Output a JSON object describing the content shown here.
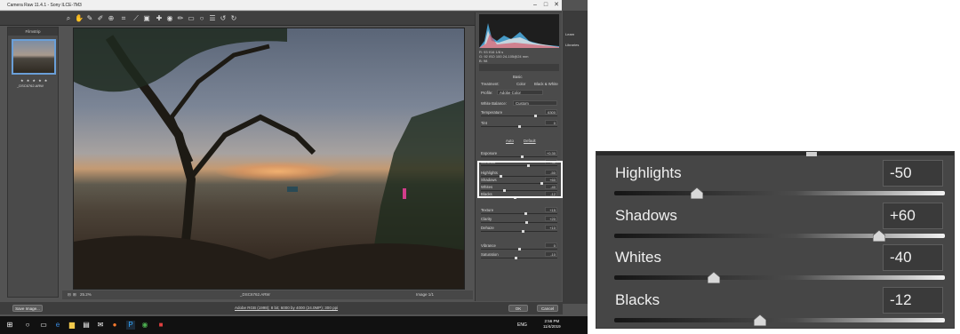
{
  "window": {
    "title": "Camera Raw 11.4.1  -  Sony ILCE-7M3"
  },
  "filmstrip": {
    "header": "Filmstrip",
    "stars": "★ ★ ★ ★ ★",
    "thumb_name": "_DSC6762.ARW"
  },
  "camera_readout": {
    "line1": "R:  93     f/16    1/8 s",
    "line2": "G:  92     ISO 100   24-105@24 mm",
    "line3": "B:  98"
  },
  "basic_panel": {
    "title": "Basic",
    "treatment_label": "Treatment:",
    "treatment_color": "Color",
    "treatment_bw": "Black & White",
    "profile_label": "Profile:",
    "profile_value": "Adobe Color",
    "wb_label": "White Balance:",
    "wb_value": "Custom",
    "auto": "Auto",
    "default": "Default",
    "sliders": [
      {
        "label": "Temperature",
        "value": "6300",
        "pos": 0.72
      },
      {
        "label": "Tint",
        "value": "0",
        "pos": 0.5
      },
      {
        "label": "Exposure",
        "value": "+0.30",
        "pos": 0.54
      },
      {
        "label": "Contrast",
        "value": "+30",
        "pos": 0.62
      },
      {
        "label": "Highlights",
        "value": "-50",
        "pos": 0.25
      },
      {
        "label": "Shadows",
        "value": "+60",
        "pos": 0.8
      },
      {
        "label": "Whites",
        "value": "-40",
        "pos": 0.3
      },
      {
        "label": "Blacks",
        "value": "-12",
        "pos": 0.44
      },
      {
        "label": "Texture",
        "value": "+15",
        "pos": 0.58
      },
      {
        "label": "Clarity",
        "value": "+20",
        "pos": 0.6
      },
      {
        "label": "Dehaze",
        "value": "+10",
        "pos": 0.55
      },
      {
        "label": "Vibrance",
        "value": "0",
        "pos": 0.5
      },
      {
        "label": "Saturation",
        "value": "-10",
        "pos": 0.45
      }
    ]
  },
  "view": {
    "zoom": "25.2%",
    "filename": "_DSC6762.ARW",
    "image_counter": "Image 1/1"
  },
  "side_tabs": {
    "learn": "Learn",
    "libraries": "Libraries"
  },
  "bottom": {
    "save_image": "Save Image...",
    "workflow_link": "Adobe RGB (1998); 8 bit; 6000 by 4000 (24.0MP); 300 ppi",
    "ok": "OK",
    "cancel": "Cancel"
  },
  "taskbar": {
    "time": "2:56 PM",
    "date": "11/4/2019",
    "lang": "ENG"
  },
  "zoomed_sliders": [
    {
      "label": "Highlights",
      "value": "-50",
      "pos": 0.25
    },
    {
      "label": "Shadows",
      "value": "+60",
      "pos": 0.8
    },
    {
      "label": "Whites",
      "value": "-40",
      "pos": 0.3
    },
    {
      "label": "Blacks",
      "value": "-12",
      "pos": 0.44
    }
  ],
  "colors": {
    "panel_bg": "#464646",
    "highlight_box": "#ffffff",
    "accent_blue": "#6a9fd8"
  }
}
